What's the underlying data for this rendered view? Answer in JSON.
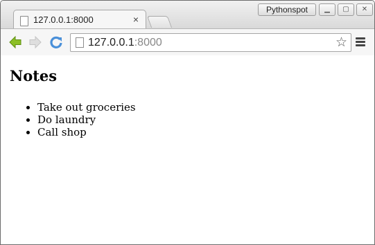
{
  "window": {
    "profile_name": "Pythonspot",
    "controls": {
      "minimize_icon": "minimize-icon",
      "maximize_icon": "maximize-icon",
      "close_icon": "close-icon"
    }
  },
  "tabs": [
    {
      "title": "127.0.0.1:8000",
      "close_label": "×",
      "active": true
    }
  ],
  "toolbar": {
    "back_icon": "back-arrow-icon",
    "forward_icon": "forward-arrow-icon",
    "reload_icon": "reload-icon",
    "url_host": "127.0.0.1",
    "url_port": ":8000",
    "bookmark_icon": "star-icon",
    "menu_icon": "hamburger-menu-icon"
  },
  "page": {
    "title": "Notes",
    "notes": [
      "Take out groceries",
      "Do laundry",
      "Call shop"
    ]
  },
  "colors": {
    "back_arrow": "#8cbf26",
    "reload": "#4a90d9"
  }
}
